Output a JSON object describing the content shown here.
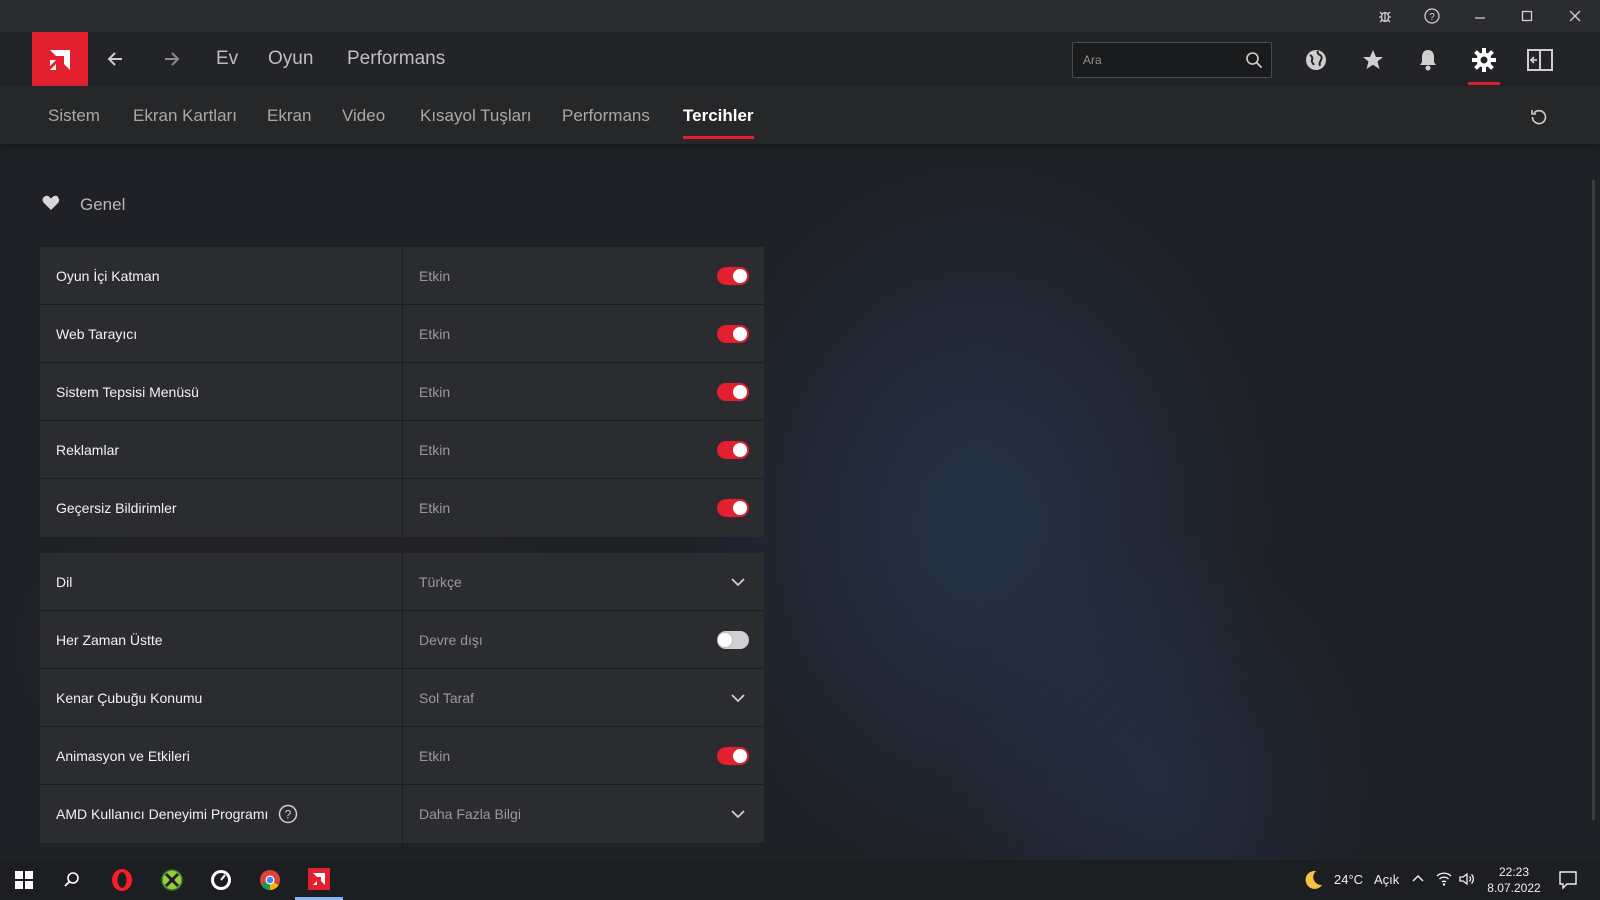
{
  "window": {
    "controls": [
      "bug-report",
      "help",
      "minimize",
      "maximize",
      "close"
    ]
  },
  "header": {
    "nav": [
      "Ev",
      "Oyun",
      "Performans"
    ],
    "search_placeholder": "Ara"
  },
  "tabs": [
    {
      "label": "Sistem",
      "active": false
    },
    {
      "label": "Ekran Kartları",
      "active": false
    },
    {
      "label": "Ekran",
      "active": false
    },
    {
      "label": "Video",
      "active": false
    },
    {
      "label": "Kısayol Tuşları",
      "active": false
    },
    {
      "label": "Performans",
      "active": false
    },
    {
      "label": "Tercihler",
      "active": true
    }
  ],
  "section": {
    "title": "Genel",
    "icon": "heart-icon"
  },
  "group1": [
    {
      "label": "Oyun İçi Katman",
      "value": "Etkin",
      "control": "toggle",
      "on": true
    },
    {
      "label": "Web Tarayıcı",
      "value": "Etkin",
      "control": "toggle",
      "on": true
    },
    {
      "label": "Sistem Tepsisi Menüsü",
      "value": "Etkin",
      "control": "toggle",
      "on": true
    },
    {
      "label": "Reklamlar",
      "value": "Etkin",
      "control": "toggle",
      "on": true
    },
    {
      "label": "Geçersiz Bildirimler",
      "value": "Etkin",
      "control": "toggle",
      "on": true
    }
  ],
  "group2": [
    {
      "label": "Dil",
      "value": "Türkçe",
      "control": "dropdown"
    },
    {
      "label": "Her Zaman Üstte",
      "value": "Devre dışı",
      "control": "toggle",
      "on": false
    },
    {
      "label": "Kenar Çubuğu Konumu",
      "value": "Sol Taraf",
      "control": "dropdown"
    },
    {
      "label": "Animasyon ve Etkileri",
      "value": "Etkin",
      "control": "toggle",
      "on": true
    },
    {
      "label": "AMD Kullanıcı Deneyimi Programı",
      "value": "Daha Fazla Bilgi",
      "control": "dropdown"
    }
  ],
  "taskbar": {
    "weather": "24°C",
    "weather_desc": "Açık",
    "time": "22:23",
    "date": "8.07.2022"
  },
  "colors": {
    "accent": "#e3202f",
    "panel": "#2b2c2f"
  }
}
